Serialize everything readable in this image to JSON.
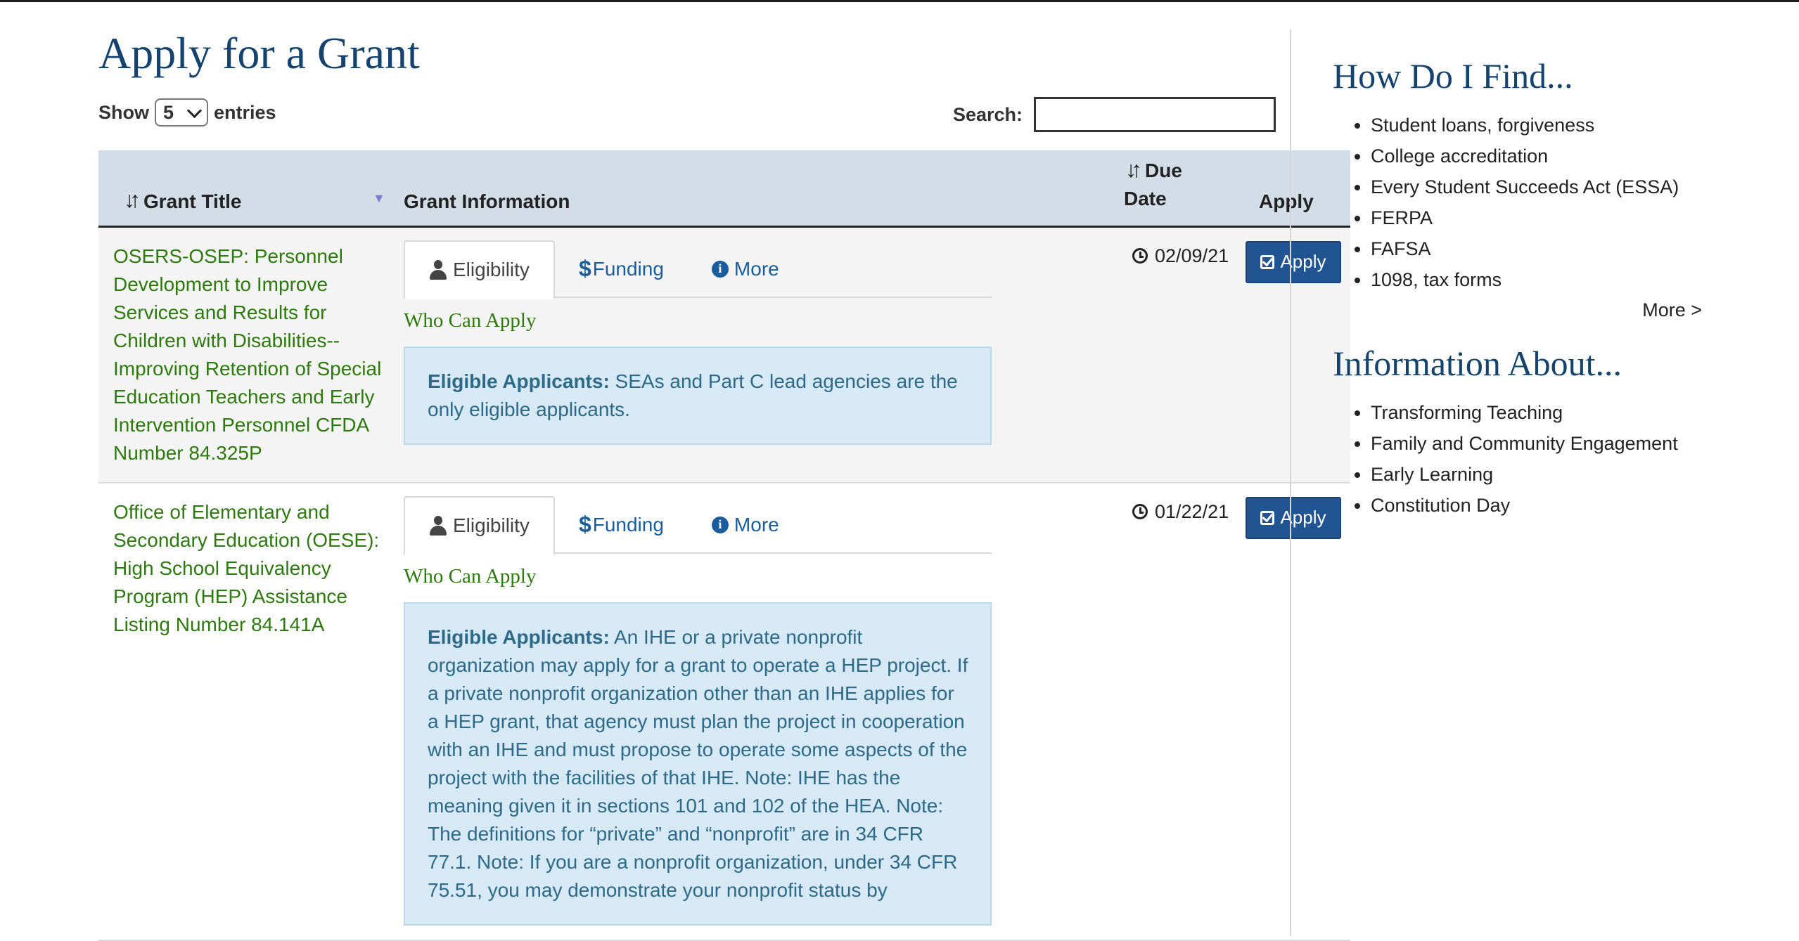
{
  "page": {
    "title": "Apply for a Grant"
  },
  "table_controls": {
    "show_label": "Show",
    "entries_value": "5",
    "entries_label": "entries",
    "search_label": "Search:",
    "search_value": ""
  },
  "columns": {
    "grant_title": "Grant Title",
    "grant_information": "Grant Information",
    "due_date_line1": "Due",
    "due_date_line2": "Date",
    "apply": "Apply"
  },
  "tabs": {
    "eligibility": "Eligibility",
    "funding": "Funding",
    "more": "More"
  },
  "rows": [
    {
      "title": "OSERS-OSEP: Personnel Development to Improve Services and Results for Children with Disabilities--Improving Retention of Special Education Teachers and Early Intervention Personnel CFDA Number 84.325P",
      "who_can_apply": "Who Can Apply",
      "eligible_label": "Eligible Applicants:",
      "eligible_text": " SEAs and Part C lead agencies are the only eligible applicants.",
      "due_date": "02/09/21",
      "apply_label": "Apply"
    },
    {
      "title": "Office of Elementary and Secondary Education (OESE): High School Equivalency Program (HEP) Assistance Listing Number 84.141A",
      "who_can_apply": "Who Can Apply",
      "eligible_label": "Eligible Applicants:",
      "eligible_text": " An IHE or a private nonprofit organization may apply for a grant to operate a HEP project. If a private nonprofit organization other than an IHE applies for a HEP grant, that agency must plan the project in cooperation with an IHE and must propose to operate some aspects of the project with the facilities of that IHE. Note: IHE has the meaning given it in sections 101 and 102 of the HEA. Note: The definitions for “private” and “nonprofit” are in 34 CFR 77.1. Note: If you are a nonprofit organization, under 34 CFR 75.51, you may demonstrate your nonprofit status by",
      "due_date": "01/22/21",
      "apply_label": "Apply"
    }
  ],
  "sidebar": {
    "find_heading": "How Do I Find...",
    "find_items": [
      "Student loans, forgiveness",
      "College accreditation",
      "Every Student Succeeds Act (ESSA)",
      "FERPA",
      "FAFSA",
      "1098, tax forms"
    ],
    "more_link": "More >",
    "about_heading": "Information About...",
    "about_items": [
      "Transforming Teaching",
      "Family and Community Engagement",
      "Early Learning",
      "Constitution Day"
    ]
  },
  "colors": {
    "heading_blue": "#14436f",
    "link_green": "#2d7a0e",
    "button_blue": "#205493",
    "header_bg": "#d3dde7",
    "eligibility_box_bg": "#d6e9f4"
  }
}
